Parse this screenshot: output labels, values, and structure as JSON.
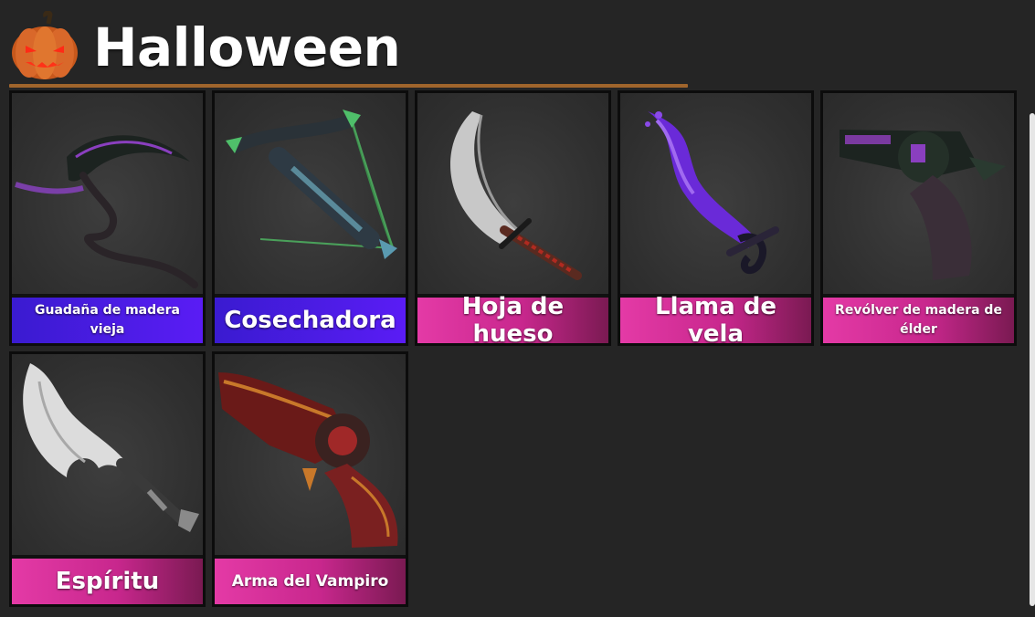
{
  "header": {
    "title": "Halloween",
    "icon": "pumpkin-icon"
  },
  "items": [
    {
      "name": "Guadaña de madera vieja",
      "rarity": "purple",
      "icon": "scythe-icon"
    },
    {
      "name": "Cosechadora",
      "rarity": "purple",
      "icon": "crossbow-icon"
    },
    {
      "name": "Hoja de hueso",
      "rarity": "pink",
      "icon": "bone-sword-icon"
    },
    {
      "name": "Llama de vela",
      "rarity": "pink",
      "icon": "flame-sword-icon"
    },
    {
      "name": "Revólver de madera de élder",
      "rarity": "pink",
      "icon": "revolver-icon"
    },
    {
      "name": "Espíritu",
      "rarity": "pink",
      "icon": "spirit-knife-icon"
    },
    {
      "name": "Arma del Vampiro",
      "rarity": "pink",
      "icon": "vampire-gun-icon"
    }
  ],
  "colors": {
    "purple": "#4a1ce8",
    "pink": "#d42f98",
    "divider": "#a0652c",
    "background": "#252525"
  }
}
